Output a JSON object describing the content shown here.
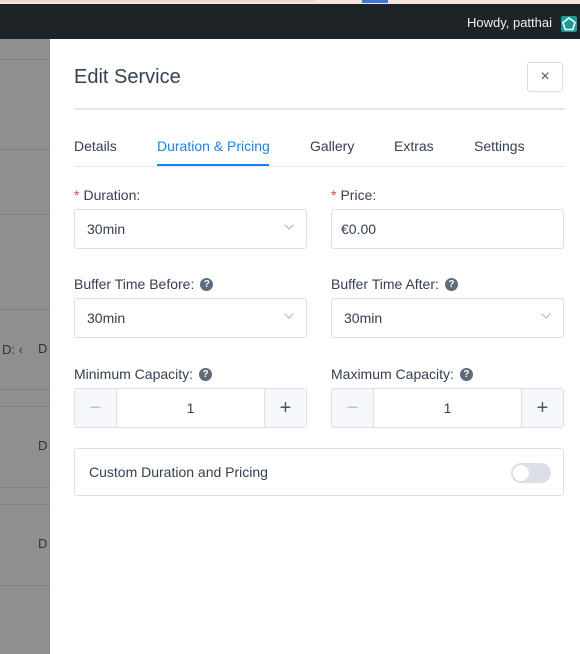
{
  "adminbar": {
    "greeting": "Howdy, patthai"
  },
  "background": {
    "partial_texts": [
      "D: ‹",
      "D",
      "D",
      "D"
    ]
  },
  "modal": {
    "title": "Edit Service",
    "close_label": "×",
    "tabs": [
      {
        "label": "Details",
        "active": false
      },
      {
        "label": "Duration & Pricing",
        "active": true
      },
      {
        "label": "Gallery",
        "active": false
      },
      {
        "label": "Extras",
        "active": false
      },
      {
        "label": "Settings",
        "active": false
      }
    ],
    "fields": {
      "duration": {
        "required_mark": "*",
        "label": "Duration:",
        "value": "30min"
      },
      "price": {
        "required_mark": "*",
        "label": "Price:",
        "value": "€0.00"
      },
      "buffer_before": {
        "label": "Buffer Time Before:",
        "value": "30min"
      },
      "buffer_after": {
        "label": "Buffer Time After:",
        "value": "30min"
      },
      "min_capacity": {
        "label": "Minimum Capacity:",
        "value": "1"
      },
      "max_capacity": {
        "label": "Maximum Capacity:",
        "value": "1"
      }
    },
    "help_glyph": "?",
    "stepper": {
      "minus": "−",
      "plus": "+"
    },
    "custom_pricing": {
      "label": "Custom Duration and Pricing",
      "enabled": false
    }
  },
  "colors": {
    "accent": "#1a84ee",
    "required": "#e6453c",
    "adminbar": "#1d2327",
    "text": "#354052"
  }
}
